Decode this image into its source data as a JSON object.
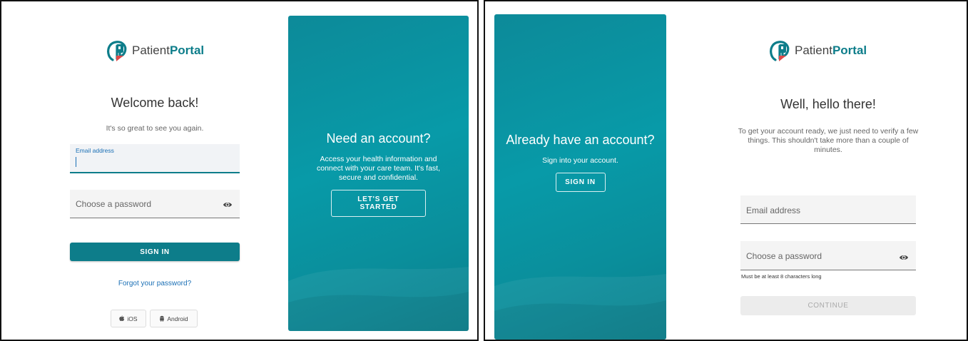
{
  "brand": {
    "name_regular": "Patient",
    "name_bold": "Portal"
  },
  "signin_screen": {
    "heading": "Welcome back!",
    "subtext": "It's so great to see you again.",
    "email_label": "Email address",
    "email_value": "",
    "password_placeholder": "Choose a password",
    "submit_label": "SIGN IN",
    "forgot_link": "Forgot your password?",
    "ios_label": "iOS",
    "android_label": "Android",
    "panel": {
      "heading": "Need an account?",
      "text": "Access your health information and connect with your care team. It's fast, secure and confidential.",
      "button_label": "LET'S GET STARTED"
    }
  },
  "signup_screen": {
    "panel": {
      "heading": "Already have an account?",
      "text": "Sign into your account.",
      "button_label": "SIGN IN"
    },
    "heading": "Well, hello there!",
    "subtext": "To get your account ready, we just need to verify a few things. This shouldn't take more than a couple of minutes.",
    "email_placeholder": "Email address",
    "password_placeholder": "Choose a password",
    "password_hint": "Must be at least 8 characters long",
    "continue_label": "CONTINUE"
  },
  "colors": {
    "teal": "#0d7d8a",
    "panel_teal": "#089aa8",
    "link_blue": "#1a6fb5",
    "logo_red": "#e04848"
  },
  "icons": [
    "patient-portal-logo-icon",
    "eye-icon",
    "apple-icon",
    "android-icon"
  ]
}
